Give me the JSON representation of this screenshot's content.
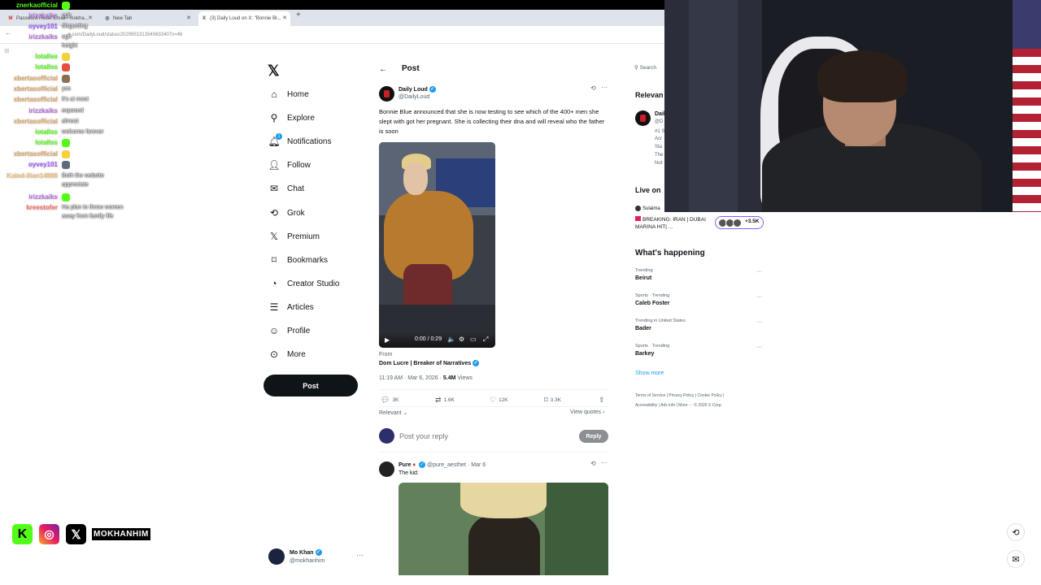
{
  "browser": {
    "tabs": [
      {
        "icon": "M",
        "title": "Password Reset Email - mokha..."
      },
      {
        "icon": "◎",
        "title": "New Tab"
      },
      {
        "icon": "X",
        "title": "(3) Daily Loud on X: \"Bonnie Bl..."
      }
    ],
    "url": "x.com/DailyLoud/status/2029951313540633407s=46"
  },
  "chat": [
    {
      "user": "znerkaofficial",
      "color": "#53fc18",
      "msg": ""
    },
    {
      "user": "irizzkaiks",
      "color": "#b96fe0",
      "msg": "ugh"
    },
    {
      "user": "oyvey101",
      "color": "#9b59ff",
      "msg": "disgusting"
    },
    {
      "user": "irizzkaiks",
      "color": "#b96fe0",
      "msg": "ugh",
      "msg2": "height"
    },
    {
      "user": "lotallss",
      "color": "#53fc18",
      "msg": ""
    },
    {
      "user": "lotallss",
      "color": "#53fc18",
      "msg": ""
    },
    {
      "user": "xbertasofficial",
      "color": "#e0a86b",
      "msg": ""
    },
    {
      "user": "xbertasofficial",
      "color": "#e0a86b",
      "msg": "yes"
    },
    {
      "user": "xbertasofficial",
      "color": "#e0a86b",
      "msg": "it's ai most"
    },
    {
      "user": "irizzkaiks",
      "color": "#b96fe0",
      "msg": "exposed"
    },
    {
      "user": "xbertasofficial",
      "color": "#e0a86b",
      "msg": "almost"
    },
    {
      "user": "lotallss",
      "color": "#53fc18",
      "msg": "welcome forever"
    },
    {
      "user": "lotallss",
      "color": "#53fc18",
      "msg": ""
    },
    {
      "user": "xbertasofficial",
      "color": "#e0a86b",
      "msg": ""
    },
    {
      "user": "oyvey101",
      "color": "#9b59ff",
      "msg": ""
    },
    {
      "user": "Kaled-Ilian14888",
      "color": "#f0c27b",
      "msg": "Both the website",
      "msg2": "appreciate"
    },
    {
      "user": "irizzkaiks",
      "color": "#b96fe0",
      "msg": ""
    },
    {
      "user": "kreestofer",
      "color": "#ff6b6b",
      "msg": "Ha plan to throw women",
      "msg2": "away from family life"
    }
  ],
  "nav": {
    "items": [
      {
        "label": "Home",
        "icon": "home-icon"
      },
      {
        "label": "Explore",
        "icon": "search-icon"
      },
      {
        "label": "Notifications",
        "icon": "bell-icon",
        "badge": "1"
      },
      {
        "label": "Follow",
        "icon": "person-add-icon"
      },
      {
        "label": "Chat",
        "icon": "mail-icon"
      },
      {
        "label": "Grok",
        "icon": "grok-icon"
      },
      {
        "label": "Premium",
        "icon": "premium-icon"
      },
      {
        "label": "Bookmarks",
        "icon": "bookmark-icon"
      },
      {
        "label": "Creator Studio",
        "icon": "studio-icon"
      },
      {
        "label": "Articles",
        "icon": "article-icon"
      },
      {
        "label": "Profile",
        "icon": "profile-icon"
      },
      {
        "label": "More",
        "icon": "more-circle-icon"
      }
    ],
    "post_label": "Post",
    "account": {
      "name": "Mo Khan",
      "handle": "@mokhanhim"
    }
  },
  "main": {
    "title": "Post",
    "tweet": {
      "name": "Daily Loud",
      "handle": "@DailyLoud",
      "text": "Bonnie Blue announced that she is now testing to see which of the 400+ men she slept with got her pregnant. She is collecting their dna and will reveal who the father is soon",
      "video_time": "0:00 / 0:29",
      "from_label": "From",
      "from_source": "Dom Lucre | Breaker of Narratives",
      "time": "11:19 AM · Mar 6, 2026 · ",
      "views": "5.4M",
      "views_label": " Views",
      "actions": {
        "replies": "3K",
        "reposts": "1.6K",
        "likes": "12K",
        "bookmarks": "3.3K"
      },
      "relevant": "Relevant",
      "view_quotes": "View quotes"
    },
    "reply_placeholder": "Post your reply",
    "reply_button": "Reply",
    "reply_tweet": {
      "name": "Pure",
      "handle": "@pure_aesthet",
      "date": "Mar 6",
      "text": "The kid:"
    }
  },
  "right": {
    "search_placeholder": "Search",
    "relevant_title": "Relevan",
    "relevant_lines": [
      "Daily",
      "@D",
      "#1 S",
      "Acr",
      "Sta",
      "The",
      "Not"
    ],
    "live_title": "Live on",
    "live_host": "Sulaima",
    "live_text": "BREAKING: IRAN | DUBAI MARINA HIT| ...",
    "live_count": "+3.5K",
    "whats_happening": "What's happening",
    "trends": [
      {
        "context": "Trending",
        "name": "Beirut"
      },
      {
        "context": "Sports · Trending",
        "name": "Caleb Foster"
      },
      {
        "context": "Trending in United States",
        "name": "Bader"
      },
      {
        "context": "Sports · Trending",
        "name": "Barkey"
      }
    ],
    "show_more": "Show more",
    "footer": [
      "Terms of Service | Privacy Policy | Cookie Policy |",
      "Accessibility | Ads info | More ··· © 2026 X Corp."
    ]
  },
  "overlay": {
    "streamer_name": "MOKHANHIM"
  }
}
